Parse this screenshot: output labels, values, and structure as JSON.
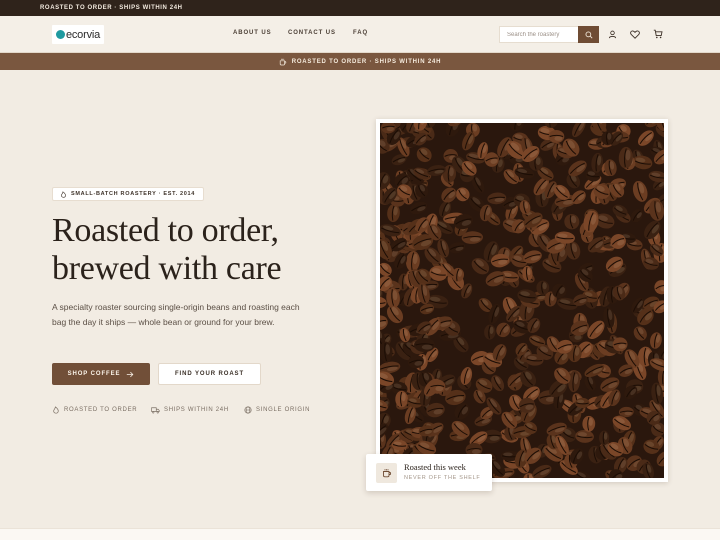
{
  "topbar": {
    "text": "ROASTED TO ORDER · SHIPS WITHIN 24H"
  },
  "header": {
    "logo_text": "ecorvia",
    "nav": [
      "ABOUT US",
      "CONTACT US",
      "FAQ"
    ],
    "search": {
      "placeholder": "Search the roastery",
      "value": ""
    },
    "icons": [
      "search-icon",
      "user-icon",
      "heart-icon",
      "cart-icon"
    ]
  },
  "promo": {
    "text": "ROASTED TO ORDER · SHIPS WITHIN 24H",
    "icon": "coffee-cup-icon"
  },
  "hero": {
    "badge": "SMALL-BATCH ROASTERY · EST. 2014",
    "title_line1": "Roasted to order,",
    "title_line2": "brewed with care",
    "subtitle": "A specialty roaster sourcing single-origin beans and roasting each bag the day it ships — whole bean or ground for your brew.",
    "primary_button": "SHOP COFFEE",
    "secondary_button": "FIND YOUR ROAST",
    "features": [
      {
        "icon": "flame-icon",
        "label": "ROASTED TO ORDER"
      },
      {
        "icon": "truck-icon",
        "label": "SHIPS WITHIN 24H"
      },
      {
        "icon": "globe-icon",
        "label": "SINGLE ORIGIN"
      }
    ]
  },
  "feature_card": {
    "title": "Roasted this week",
    "subtitle": "NEVER OFF THE SHELF",
    "icon": "coffee-cup-icon"
  },
  "colors": {
    "dark": "#2f231b",
    "brand": "#714f38",
    "promo": "#7a573f",
    "background": "#f2ece3"
  }
}
